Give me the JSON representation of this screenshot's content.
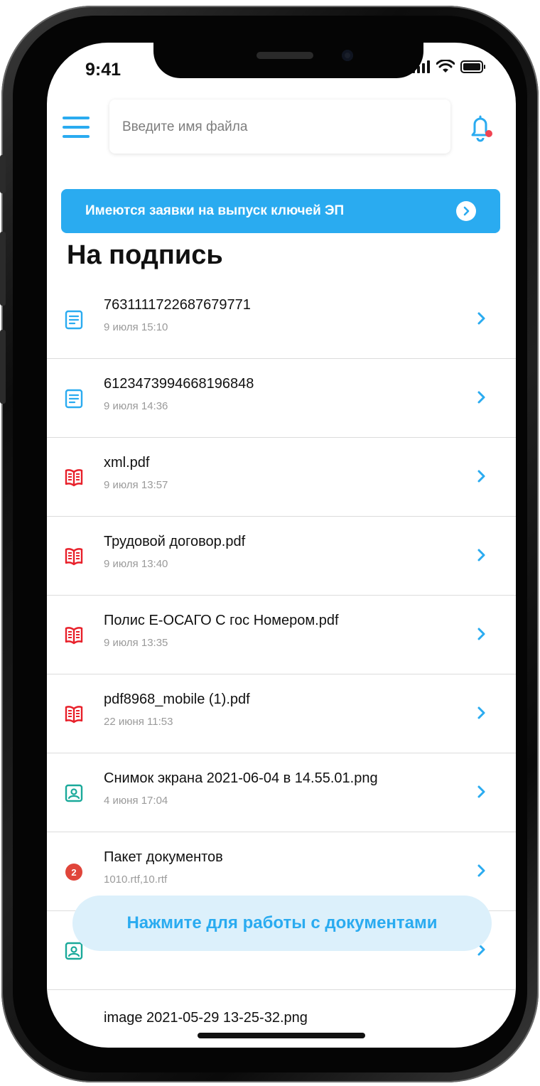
{
  "status_bar": {
    "time": "9:41"
  },
  "search": {
    "placeholder": "Введите имя файла"
  },
  "banner": {
    "text": "Имеются заявки на выпуск ключей ЭП"
  },
  "section_title": "На подпись",
  "documents": [
    {
      "name": "7631111722687679771",
      "date": "9 июля 15:10",
      "icon": "document-icon"
    },
    {
      "name": "6123473994668196848",
      "date": "9 июля 14:36",
      "icon": "document-icon"
    },
    {
      "name": "xml.pdf",
      "date": "9 июля 13:57",
      "icon": "pdf-book-icon"
    },
    {
      "name": "Трудовой договор.pdf",
      "date": "9 июля 13:40",
      "icon": "pdf-book-icon"
    },
    {
      "name": "Полис Е-ОСАГО С гос Номером.pdf",
      "date": "9 июля 13:35",
      "icon": "pdf-book-icon"
    },
    {
      "name": "pdf8968_mobile (1).pdf",
      "date": "22 июня 11:53",
      "icon": "pdf-book-icon"
    },
    {
      "name": "Снимок экрана 2021-06-04 в 14.55.01.png",
      "date": "4 июня 17:04",
      "icon": "image-file-icon"
    },
    {
      "name": "Пакет документов",
      "date": "1010.rtf,10.rtf",
      "icon": "package-badge-icon",
      "badge": "2"
    },
    {
      "name": "",
      "date": "",
      "icon": "image-file-icon"
    },
    {
      "name": "image 2021-05-29 13-25-32.png",
      "date": "",
      "icon": "image-file-icon"
    }
  ],
  "fab": {
    "label": "Нажмите для работы с документами"
  },
  "colors": {
    "accent": "#2aabf0",
    "pdf": "#e8202a",
    "image": "#1aa99a",
    "badge": "#e0453a",
    "notification_dot": "#f04452"
  }
}
